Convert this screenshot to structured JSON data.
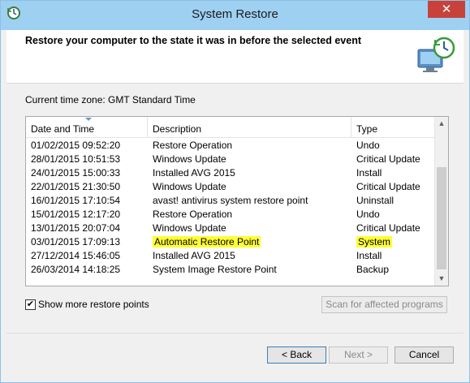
{
  "window": {
    "title": "System Restore",
    "close_glyph": "✕",
    "title_icon": "system-restore-icon",
    "colors": {
      "titlebar": "#9ed0f2",
      "close": "#c7423a",
      "highlight": "#ffff37"
    }
  },
  "header": {
    "text": "Restore your computer to the state it was in before the selected event",
    "icon": "monitor-clock-icon"
  },
  "timezone": "Current time zone: GMT Standard Time",
  "table": {
    "columns": [
      "Date and Time",
      "Description",
      "Type"
    ],
    "rows": [
      [
        "01/02/2015 09:52:20",
        "Restore Operation",
        "Undo"
      ],
      [
        "28/01/2015 10:51:53",
        "Windows Update",
        "Critical Update"
      ],
      [
        "24/01/2015 15:00:33",
        "Installed AVG 2015",
        "Install"
      ],
      [
        "22/01/2015 21:30:50",
        "Windows Update",
        "Critical Update"
      ],
      [
        "16/01/2015 17:10:54",
        "avast! antivirus system restore point",
        "Uninstall"
      ],
      [
        "15/01/2015 12:17:20",
        "Restore Operation",
        "Undo"
      ],
      [
        "13/01/2015 20:07:04",
        "Windows Update",
        "Critical Update"
      ],
      [
        "03/01/2015 17:09:13",
        "Automatic Restore Point",
        "System"
      ],
      [
        "27/12/2014 15:46:05",
        "Installed AVG 2015",
        "Install"
      ],
      [
        "26/03/2014 14:18:25",
        "System Image Restore Point",
        "Backup"
      ]
    ],
    "highlighted_row": 7
  },
  "show_more": {
    "label": "Show more restore points",
    "checked": true,
    "check_glyph": "✔"
  },
  "buttons": {
    "scan": "Scan for affected programs",
    "back": "< Back",
    "next": "Next >",
    "cancel": "Cancel"
  },
  "scrollbar": {
    "up_glyph": "▲",
    "down_glyph": "▼"
  }
}
